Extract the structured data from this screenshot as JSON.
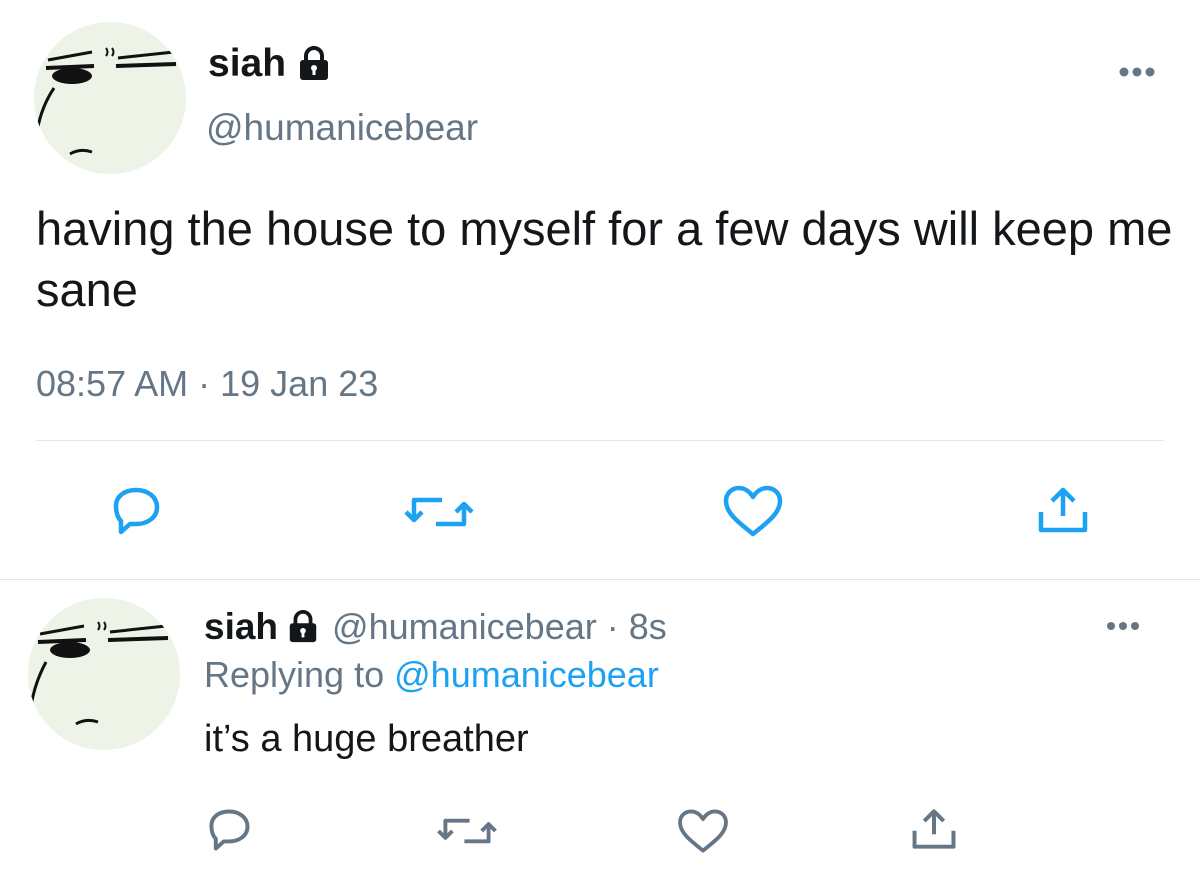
{
  "tweet": {
    "name": "siah",
    "handle": "@humanicebear",
    "text": "having the house to myself for a few days will keep me sane",
    "time": "08:57 AM",
    "separator": "·",
    "date": "19 Jan 23",
    "lock_icon": "lock-icon",
    "more_icon": "more-horizontal-icon",
    "actions": {
      "reply_icon": "reply-bubble-icon",
      "retweet_icon": "retweet-icon",
      "like_icon": "heart-icon",
      "share_icon": "share-icon"
    }
  },
  "reply": {
    "name": "siah",
    "handle": "@humanicebear",
    "separator": "·",
    "time_ago": "8s",
    "replying_to_label": "Replying to",
    "replying_to_handle": "@humanicebear",
    "text": "it’s a huge breather",
    "lock_icon": "lock-icon",
    "more_icon": "more-horizontal-icon",
    "actions": {
      "reply_icon": "reply-bubble-icon",
      "retweet_icon": "retweet-icon",
      "like_icon": "heart-icon",
      "share_icon": "share-icon"
    }
  },
  "colors": {
    "text_primary": "#14171a",
    "text_secondary": "#657786",
    "link": "#1da1f2",
    "icon": "#1da1f2",
    "divider": "#e1e8ed",
    "avatar_bg": "#edf3e7"
  }
}
